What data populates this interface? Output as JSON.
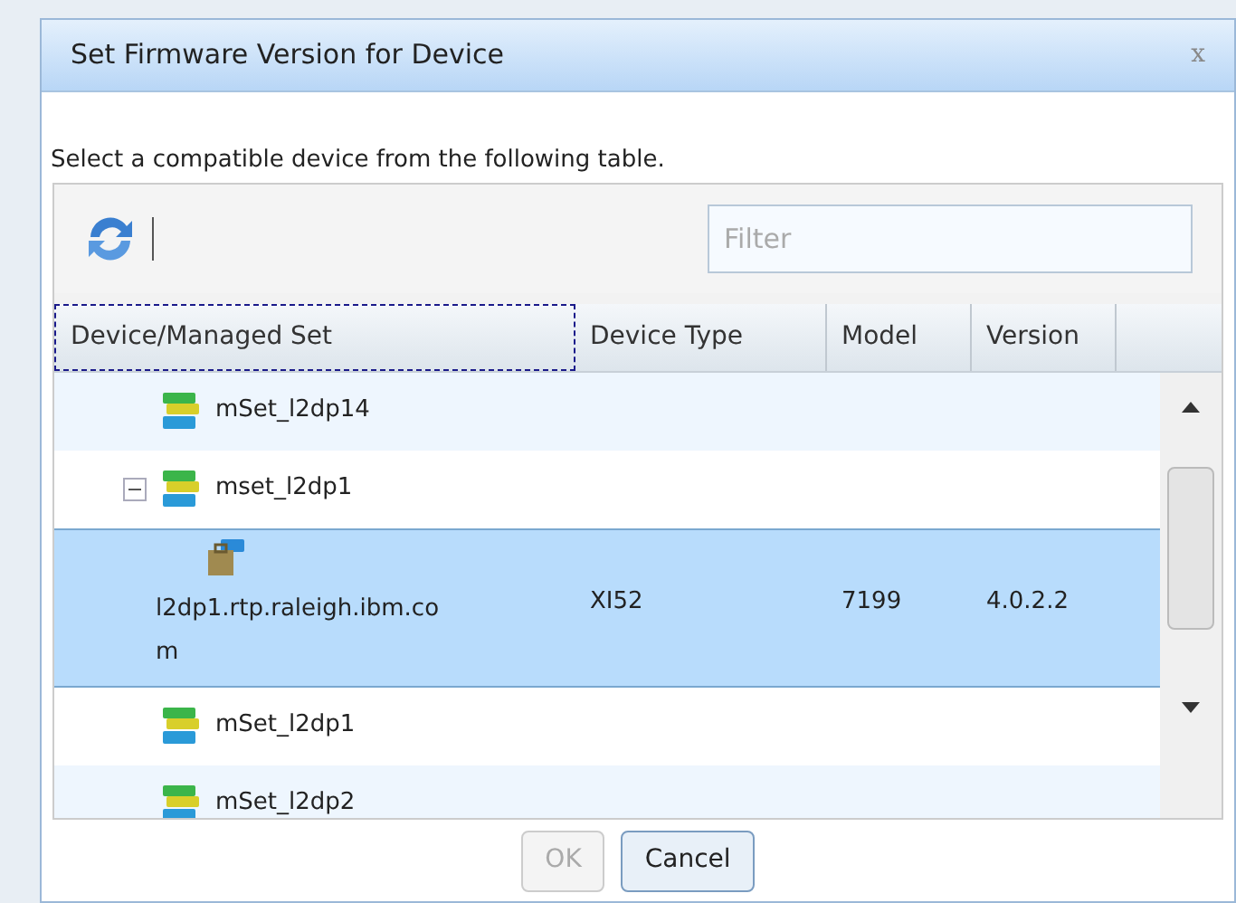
{
  "dialog": {
    "title": "Set Firmware Version for Device",
    "close": "x"
  },
  "instruction": "Select a compatible device from the following table.",
  "filter": {
    "placeholder": "Filter"
  },
  "table": {
    "columns": [
      {
        "label": "Device/Managed Set",
        "focused": true
      },
      {
        "label": "Device Type",
        "focused": false
      },
      {
        "label": "Model",
        "focused": false
      },
      {
        "label": "Version",
        "focused": false
      }
    ],
    "rows": [
      {
        "kind": "set",
        "name": "mSet_l2dp14",
        "selected": false
      },
      {
        "kind": "set",
        "name": "mset_l2dp1",
        "selected": false,
        "expanded": true,
        "children": [
          {
            "kind": "device",
            "name": "l2dp1.rtp.raleigh.ibm.com",
            "device_type": "XI52",
            "model": "7199",
            "version": "4.0.2.2",
            "selected": true
          }
        ]
      },
      {
        "kind": "set",
        "name": "mSet_l2dp1",
        "selected": false
      },
      {
        "kind": "set",
        "name": "mSet_l2dp2",
        "selected": false
      }
    ]
  },
  "buttons": [
    {
      "label": "OK",
      "disabled": true
    },
    {
      "label": "Cancel",
      "disabled": false
    }
  ]
}
